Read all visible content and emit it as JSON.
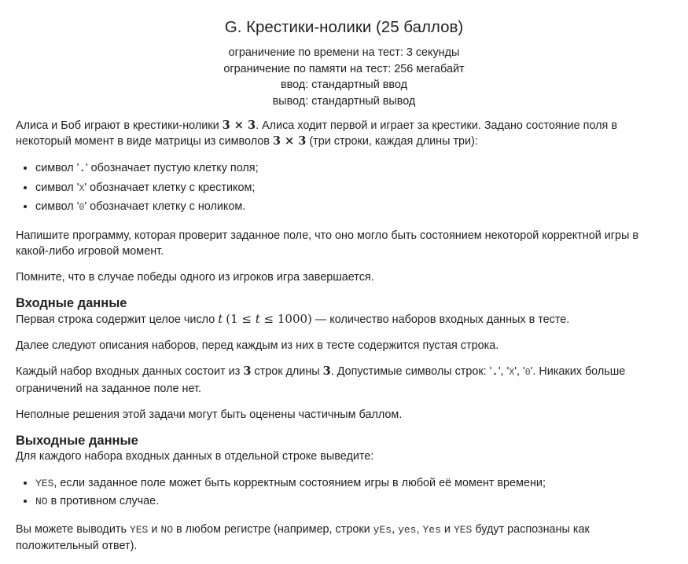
{
  "header": {
    "title": "G. Крестики-нолики (25 баллов)",
    "time_limit": "ограничение по времени на тест: 3 секунды",
    "memory_limit": "ограничение по памяти на тест: 256 мегабайт",
    "input": "ввод: стандартный ввод",
    "output": "вывод: стандартный вывод"
  },
  "legend": {
    "p1_a": "Алиса и Боб играют в крестики-нолики ",
    "p1_m1": "3 × 3",
    "p1_b": ". Алиса ходит первой и играет за крестики. Задано состояние поля в некоторый момент в виде матрицы из символов ",
    "p1_m2": "3 × 3",
    "p1_c": " (три строки, каждая длины три):",
    "items": [
      {
        "pre": "символ '",
        "code": ".",
        "post": "' обозначает пустую клетку поля;"
      },
      {
        "pre": "символ '",
        "code": "X",
        "post": "' обозначает клетку с крестиком;"
      },
      {
        "pre": "символ '",
        "code": "0",
        "post": "' обозначает клетку с ноликом."
      }
    ],
    "p2": "Напишите программу, которая проверит заданное поле, что оно могло быть состоянием некоторой корректной игры в какой-либо игровой момент.",
    "p3": "Помните, что в случае победы одного из игроков игра завершается."
  },
  "input_section": {
    "heading": "Входные данные",
    "p1_a": "Первая строка содержит целое число ",
    "p1_t": "t",
    "p1_m": "(1 ≤ ",
    "p1_t2": "t",
    "p1_m2": " ≤ 1000)",
    "p1_b": " — количество наборов входных данных в тесте.",
    "p2": "Далее следуют описания наборов, перед каждым из них в тесте содержится пустая строка.",
    "p3_a": "Каждый набор входных данных состоит из ",
    "p3_n1": "3",
    "p3_b": " строк длины ",
    "p3_n2": "3",
    "p3_c": ". Допустимые символы строк: '",
    "p3_code1": ".",
    "p3_d": "', '",
    "p3_code2": "X",
    "p3_e": "', '",
    "p3_code3": "0",
    "p3_f": "'. Никаких больше ограничений на заданное поле нет.",
    "p4": "Неполные решения этой задачи могут быть оценены частичным баллом."
  },
  "output_section": {
    "heading": "Выходные данные",
    "intro": "Для каждого набора входных данных в отдельной строке выведите:",
    "items": [
      {
        "code": "YES",
        "text": ", если заданное поле может быть корректным состоянием игры в любой её момент времени;"
      },
      {
        "code": "NO",
        "text": " в противном случае."
      }
    ],
    "final_a": "Вы можете выводить ",
    "final_c1": "YES",
    "final_b": " и ",
    "final_c2": "NO",
    "final_c": " в любом регистре (например, строки ",
    "final_c3": "yEs",
    "final_d": ", ",
    "final_c4": "yes",
    "final_e": ", ",
    "final_c5": "Yes",
    "final_f": " и ",
    "final_c6": "YES",
    "final_g": " будут распознаны как положительный ответ)."
  }
}
